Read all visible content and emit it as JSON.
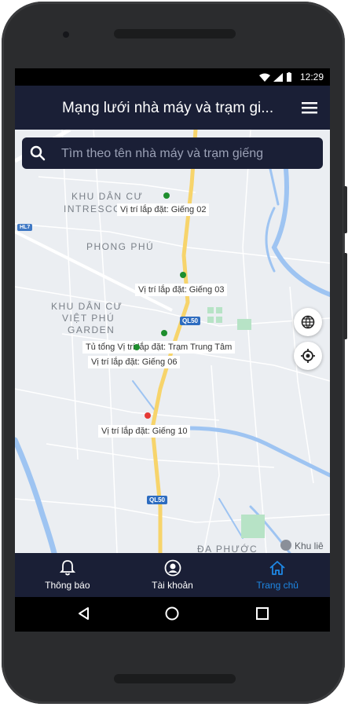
{
  "status": {
    "time": "12:29"
  },
  "appbar": {
    "title": "Mạng lưới nhà máy và trạm gi..."
  },
  "search": {
    "placeholder": "Tìm theo tên nhà máy và trạm giếng"
  },
  "map": {
    "areas": [
      "KHU DÂN CƯ",
      "INTRESCO",
      "PHONG PHÚ",
      "KHU DÂN CƯ",
      "VIỆT PHÚ",
      "GARDEN",
      "ĐA PHƯỚC",
      "Khu liê"
    ],
    "labels": [
      "Vị trí lắp đặt: Giếng 02",
      "Vị trí lắp đặt: Giếng 03",
      "Tủ tổng Vị trí lắp đặt: Trạm Trung Tâm",
      "Vị trí lắp đặt: Giếng 06",
      "Vị trí lắp đặt: Giếng 10"
    ],
    "shields": [
      "QL50",
      "QL50",
      "HL7"
    ],
    "marker_colors": {
      "ok": "#1e8e2e",
      "alert": "#e53935"
    }
  },
  "nav": {
    "items": [
      {
        "label": "Thông báo",
        "icon": "bell-icon"
      },
      {
        "label": "Tài khoản",
        "icon": "account-icon"
      },
      {
        "label": "Trang chủ",
        "icon": "home-icon"
      }
    ],
    "active_color": "#1e88e5"
  }
}
